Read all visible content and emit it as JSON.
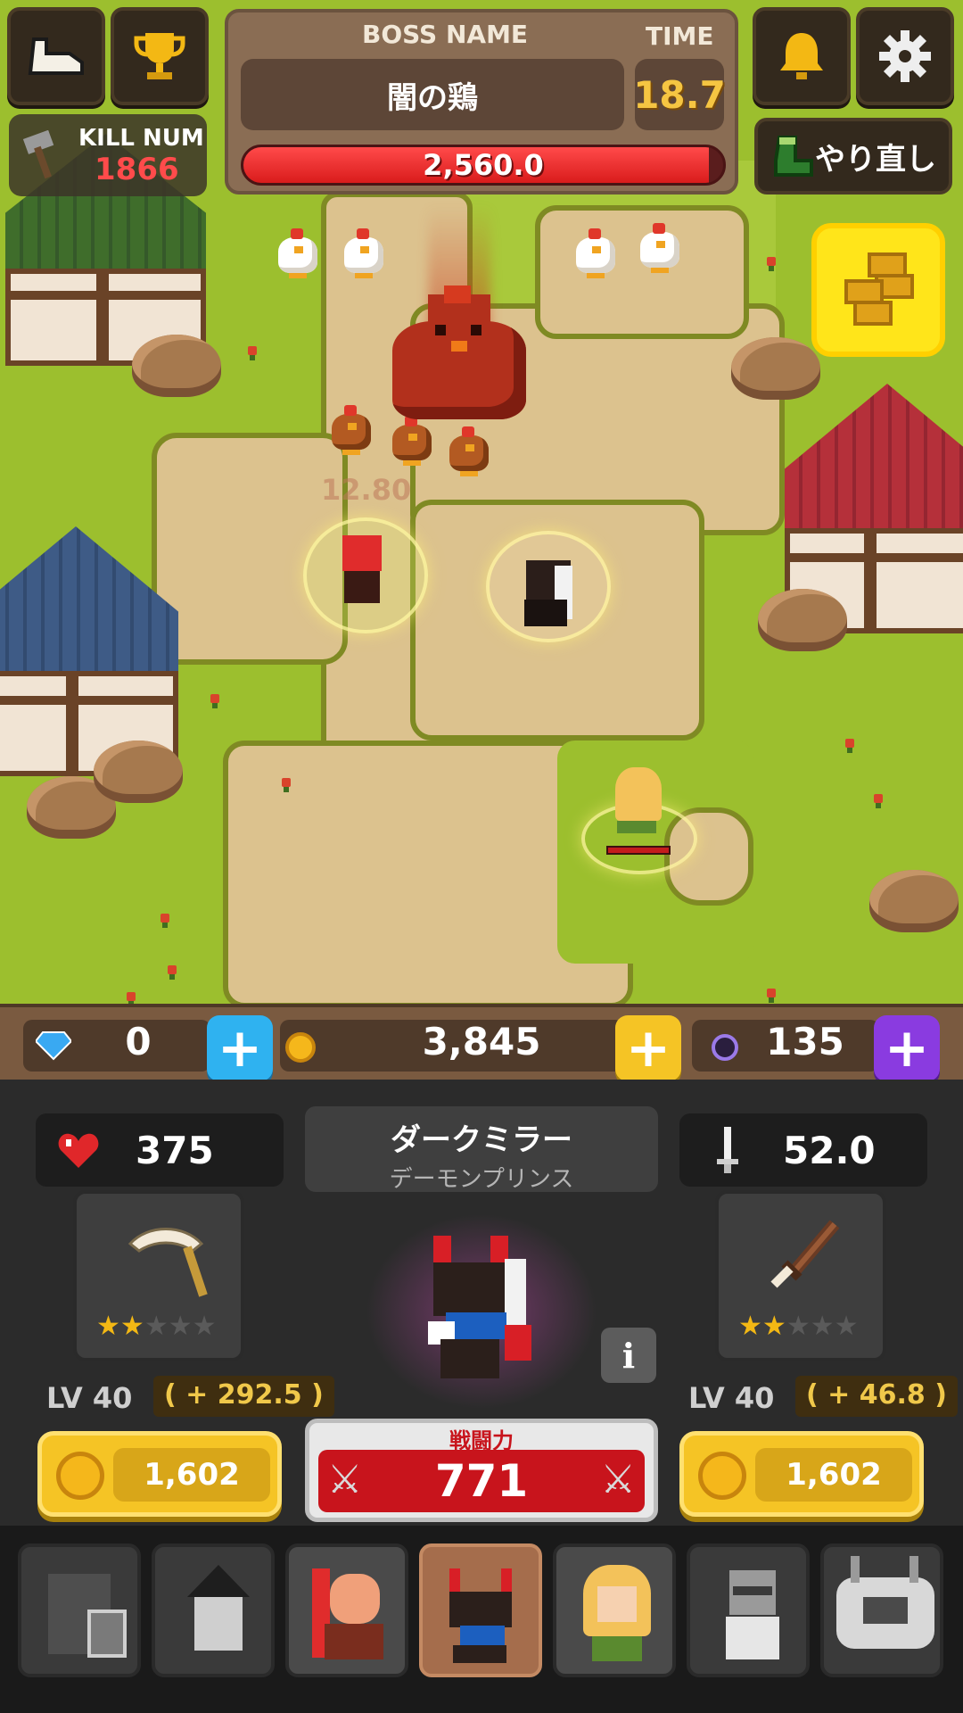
{
  "boss": {
    "name_label": "BOSS NAME",
    "time_label": "TIME",
    "name": "闇の鶏",
    "time": "18.7",
    "hp": "2,560.0",
    "hp_fraction": 0.97
  },
  "kill": {
    "label": "KILL NUM",
    "value": "1866"
  },
  "retry": {
    "label": "やり直し"
  },
  "currency": {
    "gems": "0",
    "gold": "3,845",
    "orbs": "135"
  },
  "hero": {
    "hp": "375",
    "attack": "52.0",
    "name": "ダークミラー",
    "title": "デーモンプリンス"
  },
  "left_item": {
    "level": "LV 40",
    "bonus": "( + 292.5 )",
    "cost": "1,602",
    "stars": 2,
    "max_stars": 5
  },
  "right_item": {
    "level": "LV 40",
    "bonus": "( + 46.8 )",
    "cost": "1,602",
    "stars": 2,
    "max_stars": 5
  },
  "power": {
    "label": "戦闘力",
    "value": "771"
  },
  "info_label": "i",
  "float_damage": "12.80",
  "icons": [
    "shoe-icon",
    "trophy-icon",
    "bell-icon",
    "gear-icon",
    "hammer-icon",
    "boot-icon",
    "gold-coins-icon",
    "gem-icon",
    "coin-icon",
    "orb-icon",
    "heart-icon",
    "sword-icon"
  ],
  "colors": {
    "gem_plus": "#2fb2f0",
    "gold_plus": "#f5c425",
    "orb_plus": "#8a3be0",
    "hp_red": "#e0272a",
    "power_red": "#c8141c"
  },
  "heroes": [
    "hero-slot-knight",
    "hero-slot-wizard",
    "hero-slot-redhair",
    "hero-slot-darkmirror",
    "hero-slot-elf",
    "hero-slot-scientist",
    "hero-slot-robot"
  ]
}
